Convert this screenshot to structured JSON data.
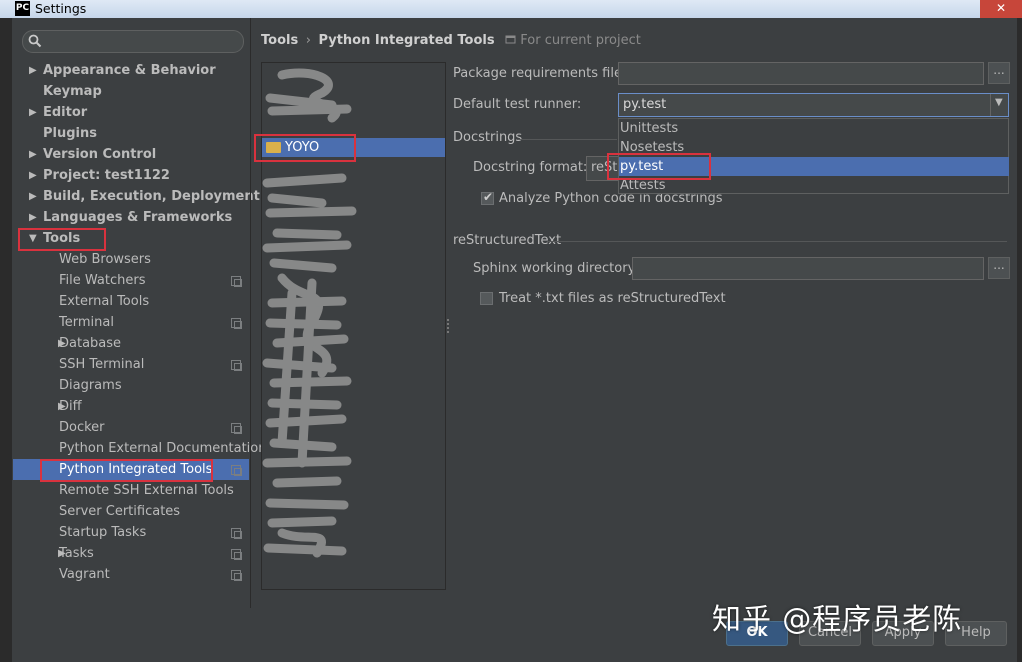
{
  "window": {
    "app_icon": "PC",
    "title": "Settings",
    "close_glyph": "✕"
  },
  "search": {
    "placeholder": ""
  },
  "tree": [
    {
      "label": "Appearance & Behavior",
      "bold": true,
      "arrow": "right",
      "indent": 0
    },
    {
      "label": "Keymap",
      "bold": true,
      "arrow": "",
      "indent": 0
    },
    {
      "label": "Editor",
      "bold": true,
      "arrow": "right",
      "indent": 0
    },
    {
      "label": "Plugins",
      "bold": true,
      "arrow": "",
      "indent": 0
    },
    {
      "label": "Version Control",
      "bold": true,
      "arrow": "right",
      "indent": 0
    },
    {
      "label": "Project: test1122",
      "bold": true,
      "arrow": "right",
      "indent": 0
    },
    {
      "label": "Build, Execution, Deployment",
      "bold": true,
      "arrow": "right",
      "indent": 0
    },
    {
      "label": "Languages & Frameworks",
      "bold": true,
      "arrow": "right",
      "indent": 0
    },
    {
      "label": "Tools",
      "bold": true,
      "arrow": "down",
      "indent": 0
    },
    {
      "label": "Web Browsers",
      "bold": false,
      "arrow": "",
      "indent": 1
    },
    {
      "label": "File Watchers",
      "bold": false,
      "arrow": "",
      "indent": 1,
      "copy": true
    },
    {
      "label": "External Tools",
      "bold": false,
      "arrow": "",
      "indent": 1
    },
    {
      "label": "Terminal",
      "bold": false,
      "arrow": "",
      "indent": 1,
      "copy": true
    },
    {
      "label": "Database",
      "bold": false,
      "arrow": "right",
      "indent": 1
    },
    {
      "label": "SSH Terminal",
      "bold": false,
      "arrow": "",
      "indent": 1,
      "copy": true
    },
    {
      "label": "Diagrams",
      "bold": false,
      "arrow": "",
      "indent": 1
    },
    {
      "label": "Diff",
      "bold": false,
      "arrow": "right",
      "indent": 1
    },
    {
      "label": "Docker",
      "bold": false,
      "arrow": "",
      "indent": 1,
      "copy": true
    },
    {
      "label": "Python External Documentation",
      "bold": false,
      "arrow": "",
      "indent": 1
    },
    {
      "label": "Python Integrated Tools",
      "bold": false,
      "arrow": "",
      "indent": 1,
      "copy": true,
      "selected": true
    },
    {
      "label": "Remote SSH External Tools",
      "bold": false,
      "arrow": "",
      "indent": 1
    },
    {
      "label": "Server Certificates",
      "bold": false,
      "arrow": "",
      "indent": 1
    },
    {
      "label": "Startup Tasks",
      "bold": false,
      "arrow": "",
      "indent": 1,
      "copy": true
    },
    {
      "label": "Tasks",
      "bold": false,
      "arrow": "right",
      "indent": 1,
      "copy": true
    },
    {
      "label": "Vagrant",
      "bold": false,
      "arrow": "",
      "indent": 1,
      "copy": true
    }
  ],
  "breadcrumb": {
    "part1": "Tools",
    "separator": "›",
    "part2": "Python Integrated Tools",
    "hint": "For current project"
  },
  "project_list": {
    "selected": "YOYO"
  },
  "form": {
    "package_req_label": "Package requirements file:",
    "package_req_value": "",
    "default_runner_label": "Default test runner:",
    "default_runner_value": "py.test",
    "runner_options": [
      "Unittests",
      "Nosetests",
      "py.test",
      "Attests"
    ],
    "runner_selected_index": 2,
    "docstrings_section": "Docstrings",
    "docstring_format_label": "Docstring format:",
    "docstring_format_value": "reSt",
    "analyze_label": "Analyze Python code in docstrings",
    "analyze_checked": true,
    "rst_section": "reStructuredText",
    "sphinx_label": "Sphinx working directory:",
    "sphinx_value": "",
    "treat_txt_label": "Treat *.txt files as reStructuredText",
    "treat_txt_checked": false,
    "browse_label": "..."
  },
  "buttons": {
    "ok": "OK",
    "cancel": "Cancel",
    "apply": "Apply",
    "help": "Help"
  },
  "watermark": "知乎 @程序员老陈",
  "colors": {
    "background": "#3c3f41",
    "selection": "#4b6eaf",
    "highlight_box": "#d9323e"
  }
}
